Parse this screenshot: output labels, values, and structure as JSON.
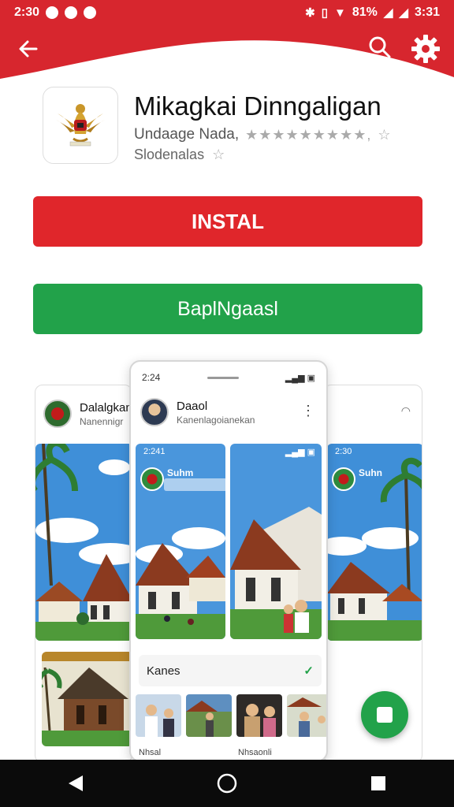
{
  "status_bar": {
    "left_time": "2:30",
    "battery": "81%",
    "right_time": "3:31"
  },
  "header": {
    "back_icon": "arrow-left-icon",
    "search_icon": "search-icon",
    "settings_icon": "gear-icon",
    "color": "#d7262e"
  },
  "app": {
    "title": "Mikagkai Dinngaligan",
    "developer": "Undaage Nada,",
    "rating_stars": "★★★★★★★★★,",
    "extra_star": "☆",
    "subtitle": "Slodenalas",
    "subtitle_star": "☆"
  },
  "buttons": {
    "install_label": "INSTAL",
    "secondary_label": "BaplNgaasl"
  },
  "screenshots": {
    "left_card": {
      "name": "Dalalgkan",
      "sub": "Nanennigr"
    },
    "center_card": {
      "time": "2:24",
      "profile_name": "Daaol",
      "profile_sub": "Kanenlagoianekan",
      "scene1_time": "2:241",
      "scene1_name": "Suhm",
      "kanes_label": "Kanes",
      "caption_left": "Nhsal",
      "caption_right": "Nhsaonli"
    },
    "right_card": {
      "scene_time": "2:30",
      "scene_name": "Suhn"
    }
  },
  "colors": {
    "install": "#e0262b",
    "secondary": "#22a24a",
    "fab": "#22a24a"
  },
  "nav": {
    "back": "triangle-back-icon",
    "home": "circle-home-icon",
    "recents": "square-recents-icon"
  }
}
